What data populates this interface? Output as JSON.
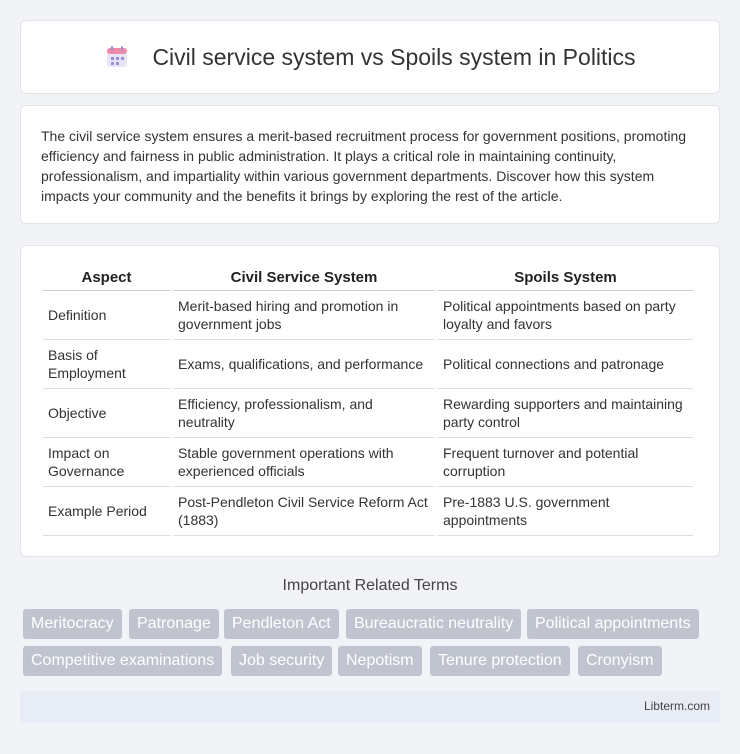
{
  "header": {
    "title": "Civil service system vs Spoils system in Politics",
    "icon": "calendar-icon"
  },
  "intro": {
    "text": "The civil service system ensures a merit-based recruitment process for government positions, promoting efficiency and fairness in public administration. It plays a critical role in maintaining continuity, professionalism, and impartiality within various government departments. Discover how this system impacts your community and the benefits it brings by exploring the rest of the article."
  },
  "table": {
    "headers": [
      "Aspect",
      "Civil Service System",
      "Spoils System"
    ],
    "rows": [
      [
        "Definition",
        "Merit-based hiring and promotion in government jobs",
        "Political appointments based on party loyalty and favors"
      ],
      [
        "Basis of Employment",
        "Exams, qualifications, and performance",
        "Political connections and patronage"
      ],
      [
        "Objective",
        "Efficiency, professionalism, and neutrality",
        "Rewarding supporters and maintaining party control"
      ],
      [
        "Impact on Governance",
        "Stable government operations with experienced officials",
        "Frequent turnover and potential corruption"
      ],
      [
        "Example Period",
        "Post-Pendleton Civil Service Reform Act (1883)",
        "Pre-1883 U.S. government appointments"
      ]
    ]
  },
  "terms": {
    "title": "Important Related Terms",
    "items": [
      "Meritocracy",
      "Patronage",
      "Pendleton Act",
      "Bureaucratic neutrality",
      "Political appointments",
      "Competitive examinations",
      "Job security",
      "Nepotism",
      "Tenure protection",
      "Cronyism"
    ]
  },
  "footer": {
    "text": "Libterm.com"
  },
  "colors": {
    "background": "#f2f3f7",
    "tag": "#bfc4cf",
    "footer": "#e8ecf4"
  }
}
